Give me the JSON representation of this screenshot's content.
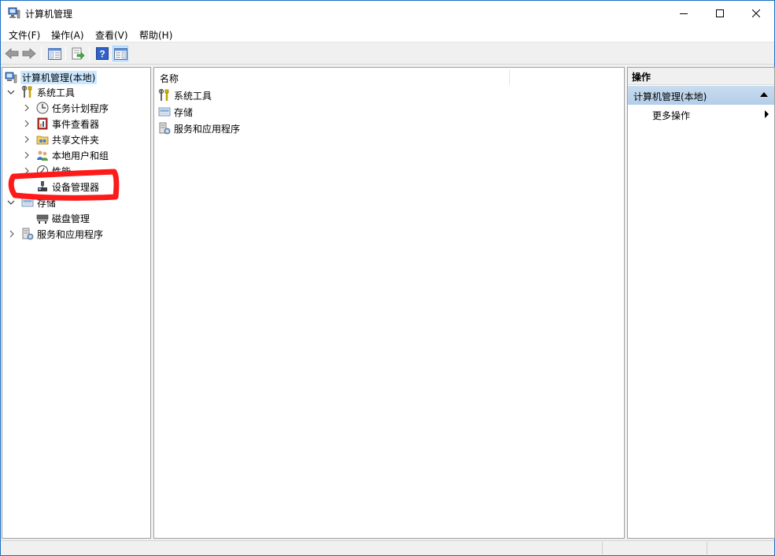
{
  "window": {
    "title": "计算机管理",
    "controls": {
      "minimize": "minimize",
      "maximize": "maximize",
      "close": "close"
    }
  },
  "menu": {
    "items": [
      {
        "label": "文件(F)"
      },
      {
        "label": "操作(A)"
      },
      {
        "label": "查看(V)"
      },
      {
        "label": "帮助(H)"
      }
    ]
  },
  "toolbar": {
    "buttons": [
      "back-icon",
      "forward-icon",
      "console-tree-icon",
      "export-list-icon",
      "help-icon",
      "show-action-pane-icon"
    ]
  },
  "tree": {
    "root": {
      "label": "计算机管理(本地)",
      "icon": "computer-management-icon"
    },
    "items": [
      {
        "label": "系统工具",
        "icon": "tools-icon",
        "expanded": true
      },
      {
        "label": "任务计划程序",
        "icon": "clock-icon"
      },
      {
        "label": "事件查看器",
        "icon": "event-viewer-icon"
      },
      {
        "label": "共享文件夹",
        "icon": "shared-folder-icon"
      },
      {
        "label": "本地用户和组",
        "icon": "users-icon"
      },
      {
        "label": "性能",
        "icon": "performance-icon"
      },
      {
        "label": "设备管理器",
        "icon": "device-manager-icon"
      },
      {
        "label": "存储",
        "icon": "storage-icon",
        "expanded": true
      },
      {
        "label": "磁盘管理",
        "icon": "disk-management-icon"
      },
      {
        "label": "服务和应用程序",
        "icon": "services-icon"
      }
    ]
  },
  "list": {
    "column_header": "名称",
    "rows": [
      {
        "label": "系统工具",
        "icon": "tools-icon"
      },
      {
        "label": "存储",
        "icon": "storage-icon"
      },
      {
        "label": "服务和应用程序",
        "icon": "services-icon"
      }
    ]
  },
  "actions": {
    "header": "操作",
    "section": "计算机管理(本地)",
    "more": "更多操作"
  },
  "colors": {
    "selection": "#cce8ff",
    "action_section": "#b3cde8",
    "annotation": "#ff1a1a",
    "window_border": "#1e6fc0"
  }
}
